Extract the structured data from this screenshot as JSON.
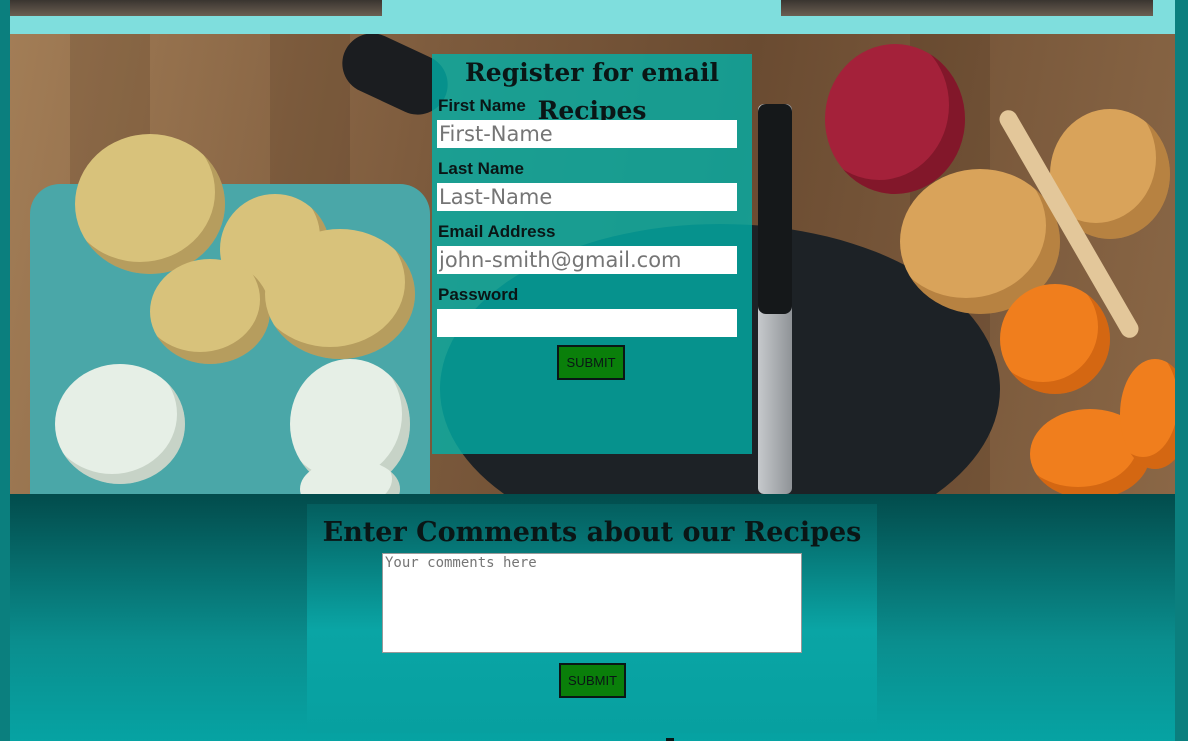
{
  "register_form": {
    "title": "Register for email Recipes",
    "first_name_label": "First Name",
    "first_name_placeholder": "First-Name",
    "last_name_label": "Last Name",
    "last_name_placeholder": "Last-Name",
    "email_label": "Email Address",
    "email_placeholder": "john-smith@gmail.com",
    "password_label": "Password",
    "password_value": "",
    "submit_label": "SUBMIT"
  },
  "comments_form": {
    "title": "Enter Comments about our Recipes Here",
    "textarea_placeholder": "Your comments here",
    "submit_label": "SUBMIT"
  },
  "colors": {
    "accent": "#00b2aa",
    "button": "#0a7f0a",
    "top_strip": "#7fdedd",
    "dark_teal": "#024c4c"
  }
}
